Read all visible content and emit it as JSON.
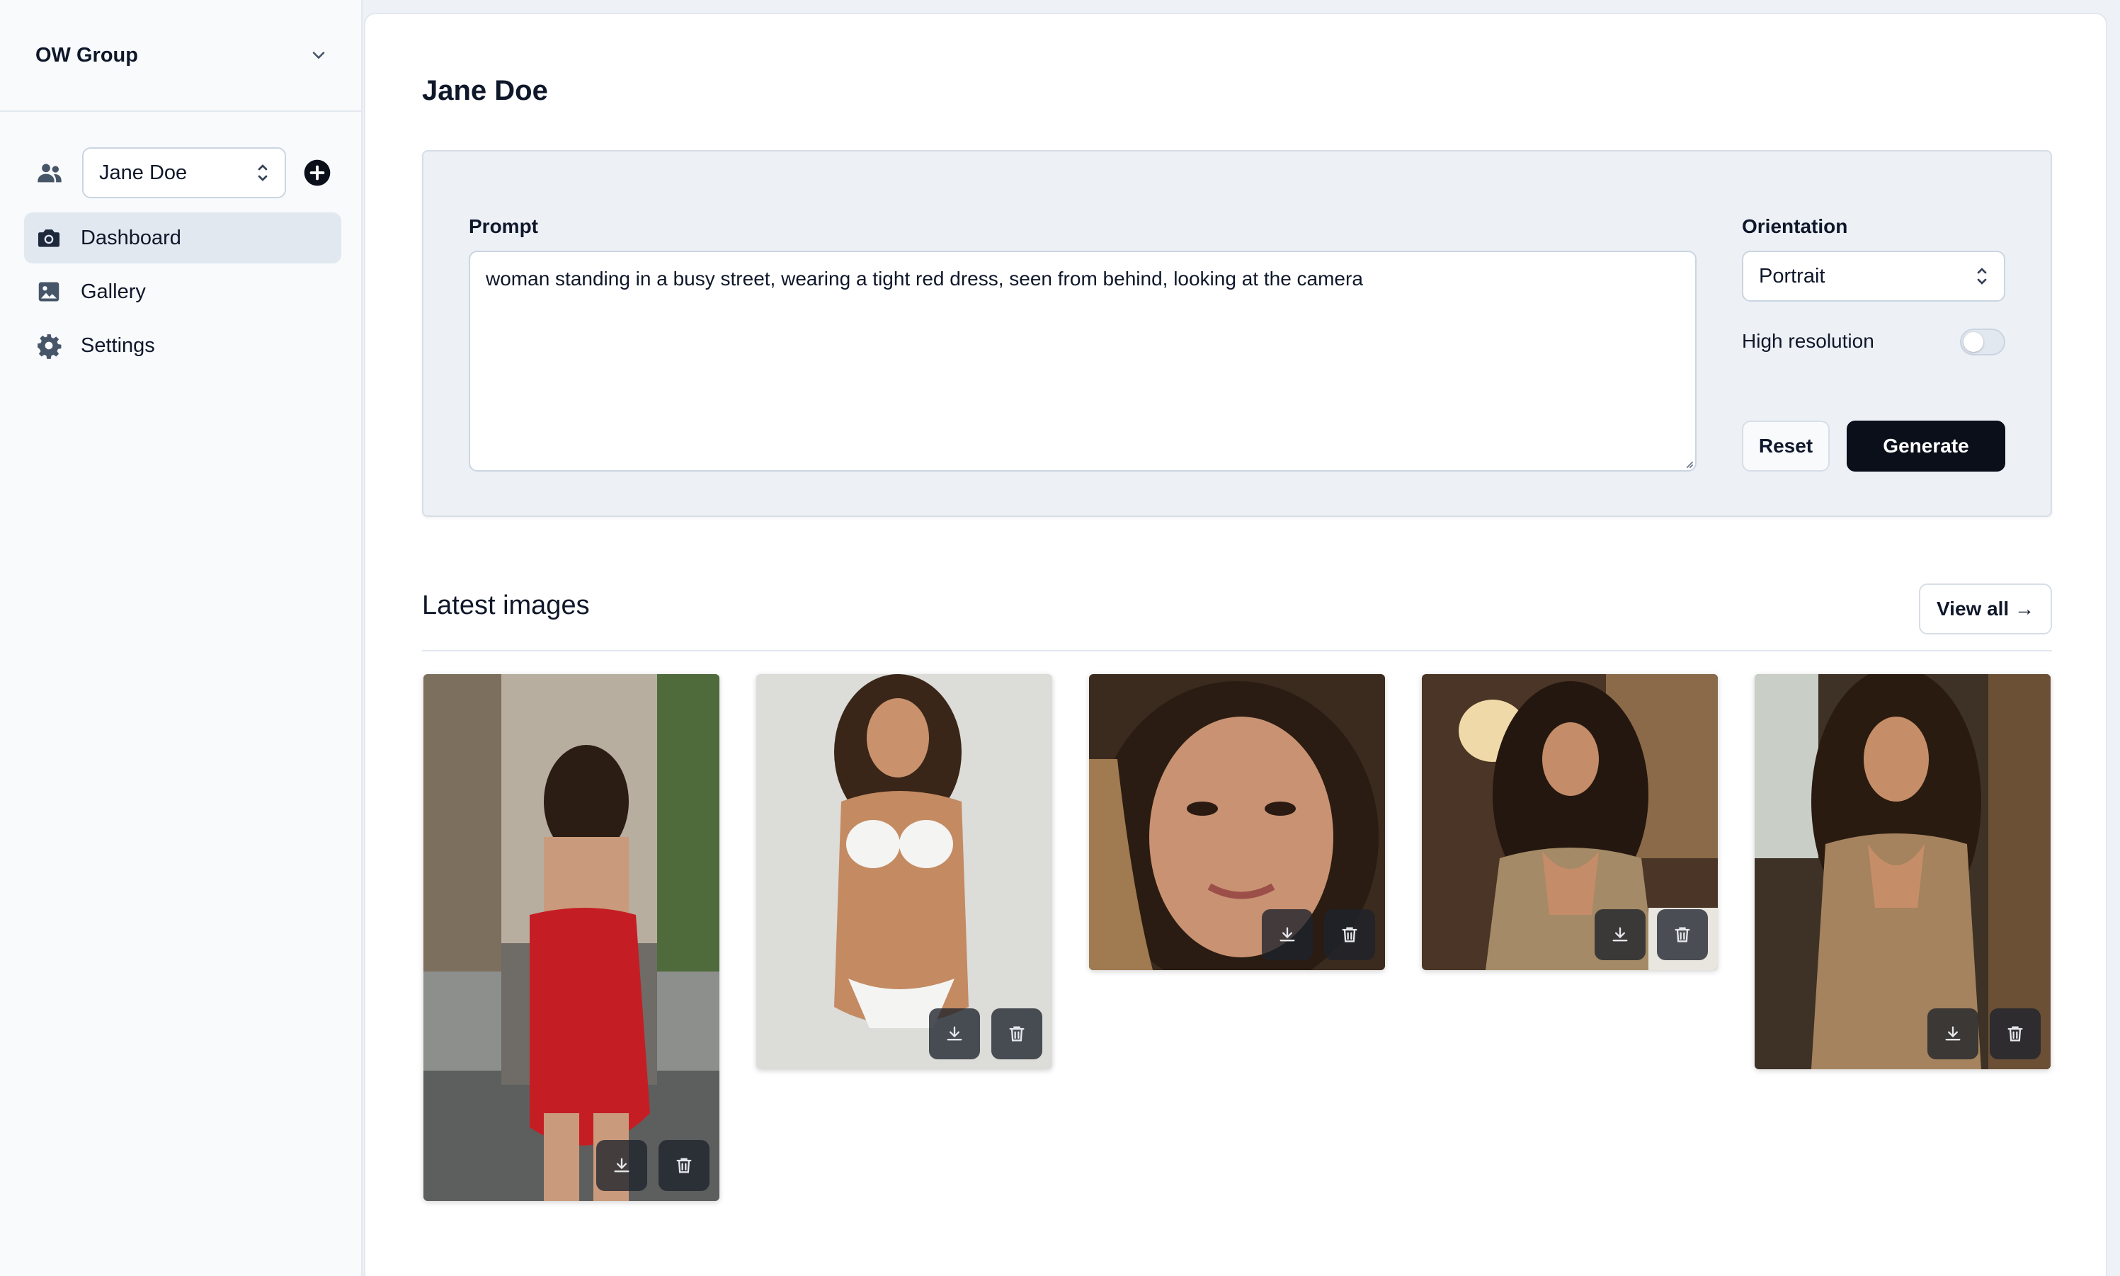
{
  "sidebar": {
    "org_name": "OW Group",
    "persona_selected": "Jane Doe",
    "nav": [
      {
        "label": "Dashboard",
        "icon": "camera-icon",
        "active": true
      },
      {
        "label": "Gallery",
        "icon": "image-icon",
        "active": false
      },
      {
        "label": "Settings",
        "icon": "gear-icon",
        "active": false
      }
    ]
  },
  "main": {
    "title": "Jane Doe",
    "generator": {
      "prompt_label": "Prompt",
      "prompt_value": "woman standing in a busy street, wearing a tight red dress, seen from behind, looking at the camera",
      "orientation_label": "Orientation",
      "orientation_value": "Portrait",
      "high_res_label": "High resolution",
      "high_res_enabled": false,
      "reset_label": "Reset",
      "generate_label": "Generate"
    },
    "latest": {
      "title": "Latest images",
      "view_all_label": "View all →",
      "images": [
        {
          "orientation": "portrait"
        },
        {
          "orientation": "portrait"
        },
        {
          "orientation": "square"
        },
        {
          "orientation": "square"
        },
        {
          "orientation": "portrait"
        }
      ]
    }
  },
  "colors": {
    "primary_button": "#0b0f1a",
    "panel_bg": "#edf1f6",
    "active_nav_bg": "#e2e8f0"
  }
}
